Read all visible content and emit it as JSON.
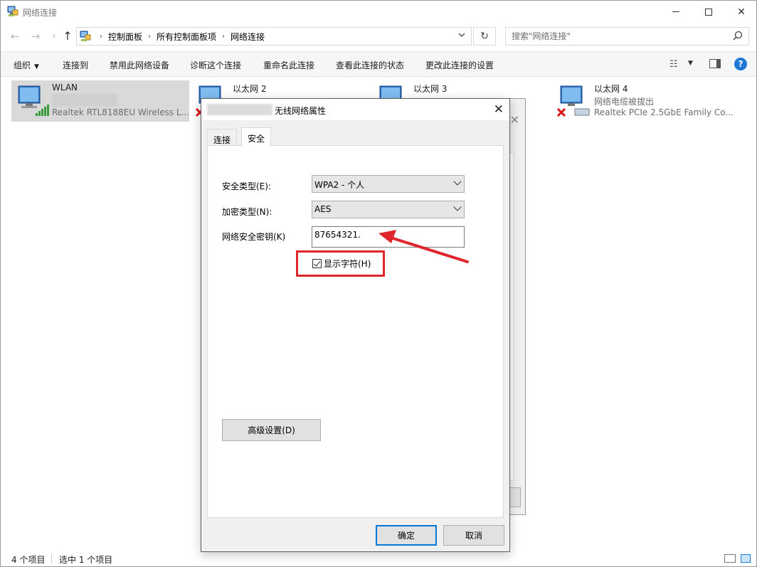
{
  "window": {
    "title": "网络连接",
    "minimize_icon": "minimize-icon",
    "maximize_icon": "maximize-icon",
    "close_glyph": "✕"
  },
  "nav": {
    "back_glyph": "←",
    "forward_glyph": "→",
    "recent_glyph": "∨",
    "up_glyph": "↑",
    "breadcrumbs": [
      "控制面板",
      "所有控制面板项",
      "网络连接"
    ],
    "breadcrumb_sep": "›",
    "refresh_glyph": "↻",
    "search_placeholder": "搜索\"网络连接\""
  },
  "commands": {
    "organize": "组织",
    "connect_to": "连接到",
    "disable": "禁用此网络设备",
    "diagnose": "诊断这个连接",
    "rename": "重命名此连接",
    "view_status": "查看此连接的状态",
    "change_settings": "更改此连接的设置",
    "view_glyph": "☷",
    "caret": "▼",
    "help": "?"
  },
  "connections": [
    {
      "name": "WLAN",
      "status": "",
      "adapter": "Realtek RTL8188EU Wireless L...",
      "selected": true
    },
    {
      "name": "以太网 2",
      "status": "",
      "adapter": "",
      "selected": false
    },
    {
      "name": "以太网 3",
      "status": "",
      "adapter": "",
      "selected": false
    },
    {
      "name": "以太网 4",
      "status": "网络电缆被拔出",
      "adapter": "Realtek PCIe 2.5GbE Family Co...",
      "selected": false
    }
  ],
  "dialog": {
    "title": "无线网络属性",
    "close_glyph": "✕",
    "tabs": [
      "连接",
      "安全"
    ],
    "active_tab": "安全",
    "security_type_label": "安全类型(E):",
    "security_type_value": "WPA2 - 个人",
    "encryption_type_label": "加密类型(N):",
    "encryption_type_value": "AES",
    "key_label": "网络安全密钥(K)",
    "key_value": "87654321.",
    "show_chars_label": "显示字符(H)",
    "show_chars_checked": true,
    "advanced_button": "高级设置(D)",
    "ok_button": "确定",
    "cancel_button": "取消"
  },
  "annotation": {
    "color": "#e0262d"
  },
  "statusbar": {
    "item_count": "4 个项目",
    "selected_count": "选中 1 个项目"
  }
}
